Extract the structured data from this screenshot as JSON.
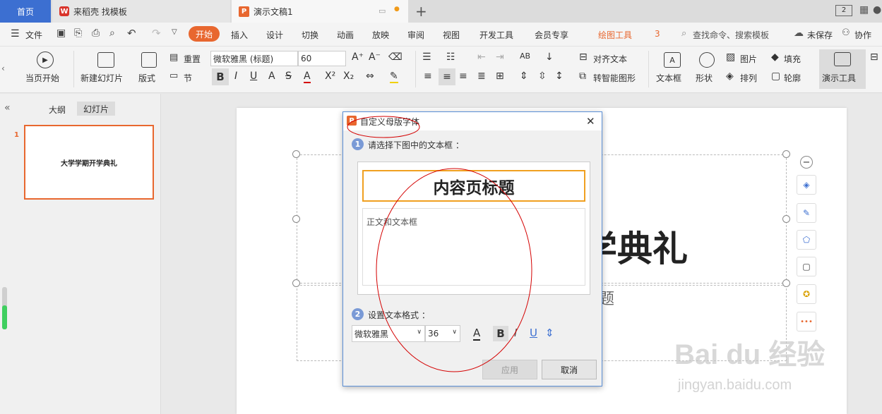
{
  "tabs": {
    "home": "首页",
    "daoke": "来稻壳 找模板",
    "doc": "演示文稿1"
  },
  "menu": {
    "file": "文件",
    "start": "开始",
    "insert": "插入",
    "design": "设计",
    "switch": "切换",
    "animation": "动画",
    "slideshow": "放映",
    "review": "审阅",
    "view": "视图",
    "devtools": "开发工具",
    "member": "会员专享",
    "drawing": "绘图工具",
    "search": "查找命令、搜索模板",
    "unsaved": "未保存",
    "collab": "协作"
  },
  "ribbon": {
    "play_current": "当页开始",
    "new_slide": "新建幻灯片",
    "layout": "版式",
    "reset": "重置",
    "section": "节",
    "font_name": "微软雅黑 (标题)",
    "font_size": "60",
    "align_text": "对齐文本",
    "smart_shape": "转智能图形",
    "textbox": "文本框",
    "shape": "形状",
    "picture": "图片",
    "arrange": "排列",
    "fill": "填充",
    "outline": "轮廓",
    "present_tools": "演示工具"
  },
  "leftpanel": {
    "outline_tab": "大纲",
    "slides_tab": "幻灯片",
    "slide_num": "1",
    "thumb_title": "大学学期开学典礼"
  },
  "slide": {
    "title_visible": "学典礼",
    "subtitle_visible": "题"
  },
  "dialog": {
    "title": "自定义母版字体",
    "step1_num": "1",
    "step1": "请选择下图中的文本框 ：",
    "preview_title": "内容页标题",
    "preview_body": "正文和文本框",
    "step2_num": "2",
    "step2": "设置文本格式 ：",
    "font": "微软雅黑",
    "size": "36",
    "apply": "应用",
    "cancel": "取消"
  },
  "watermark": {
    "brand": "Bai du 经验",
    "url": "jingyan.baidu.com"
  },
  "colors": {
    "accent": "#e8672f",
    "tab_blue": "#3c6fd1",
    "annotation_red": "#d40000",
    "dialog_border": "#5b8fd6"
  }
}
